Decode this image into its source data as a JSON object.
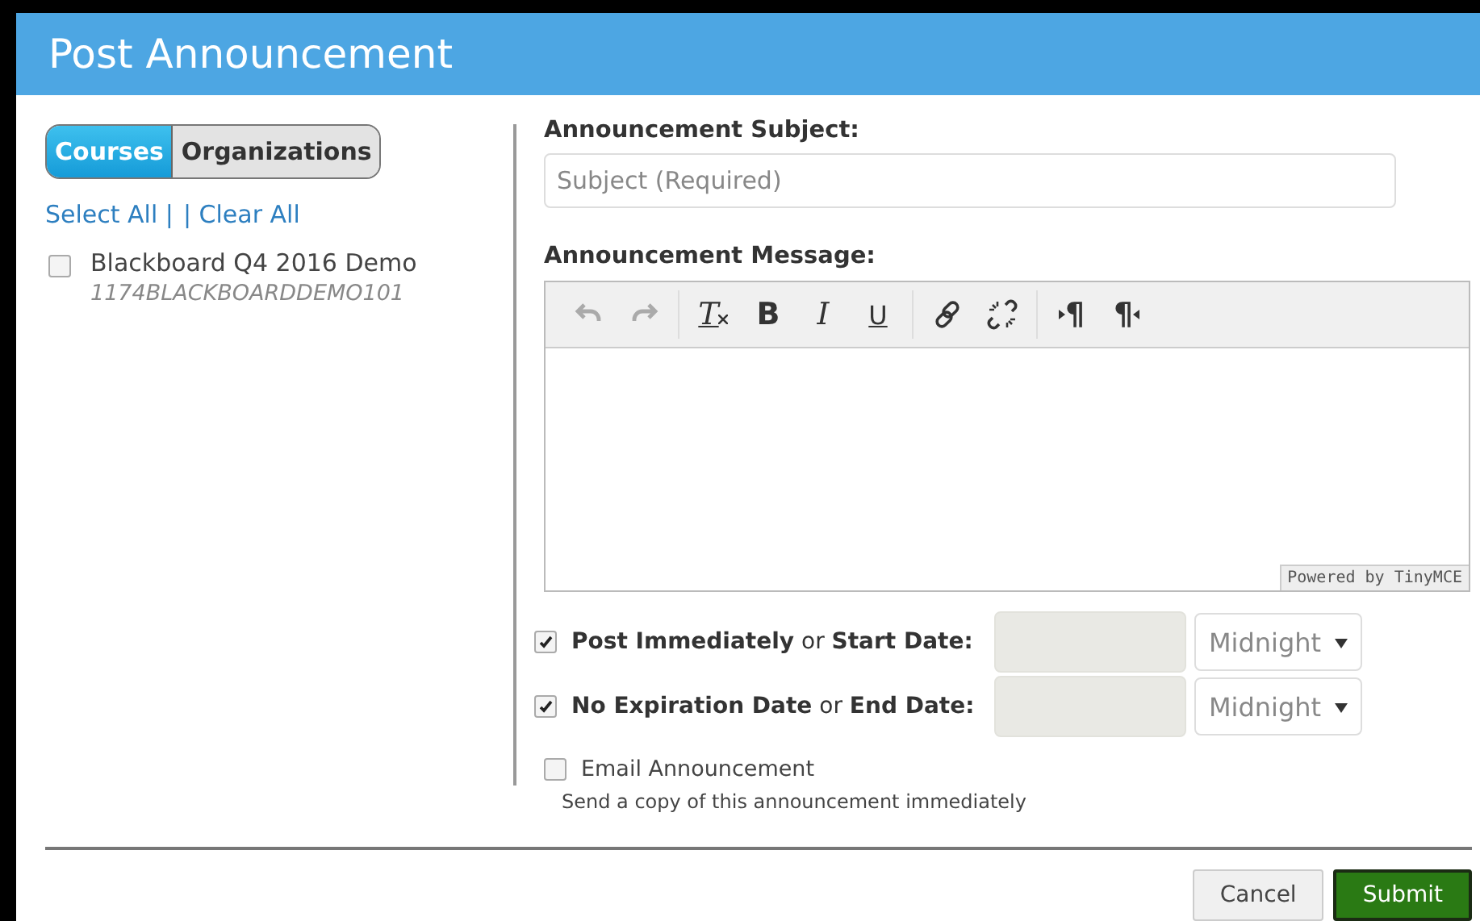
{
  "window": {
    "title": "Post Announcement"
  },
  "tabs": [
    {
      "label": "Courses",
      "selected": true
    },
    {
      "label": "Organizations",
      "selected": false
    }
  ],
  "links": [
    "Select All |",
    "| Clear All"
  ],
  "courses": [
    {
      "name": "Blackboard Q4 2016 Demo",
      "code": "1174BLACKBOARDDEMO101",
      "checked": false
    }
  ],
  "subject": {
    "label": "Announcement Subject:",
    "placeholder": "Subject (Required)"
  },
  "message": {
    "label": "Announcement Message:",
    "powered_by": "Powered by TinyMCE",
    "toolbar": [
      [
        {
          "kind": "undo",
          "disabled": true
        },
        {
          "kind": "redo",
          "disabled": true
        }
      ],
      [
        {
          "kind": "clear-format",
          "label": "T"
        },
        {
          "kind": "bold",
          "label": "B"
        },
        {
          "kind": "italic",
          "label": "I"
        },
        {
          "kind": "underline",
          "label": "U"
        }
      ],
      [
        {
          "kind": "link"
        },
        {
          "kind": "unlink"
        }
      ],
      [
        {
          "kind": "ltr",
          "label": "¶"
        },
        {
          "kind": "rtl",
          "label": "¶"
        }
      ]
    ]
  },
  "dates": [
    {
      "label": "**Post Immediately** or **Start Date:**",
      "checked": true,
      "time": "Midnight"
    },
    {
      "label": "**No Expiration Date** or **End Date:**",
      "checked": true,
      "time": "Midnight"
    }
  ],
  "email": {
    "label": "Email Announcement",
    "checked": false,
    "hint": "Send a copy of this announcement immediately"
  },
  "buttons": [
    {
      "label": "Cancel",
      "kind": "secondary"
    },
    {
      "label": "Submit",
      "kind": "primary"
    }
  ]
}
